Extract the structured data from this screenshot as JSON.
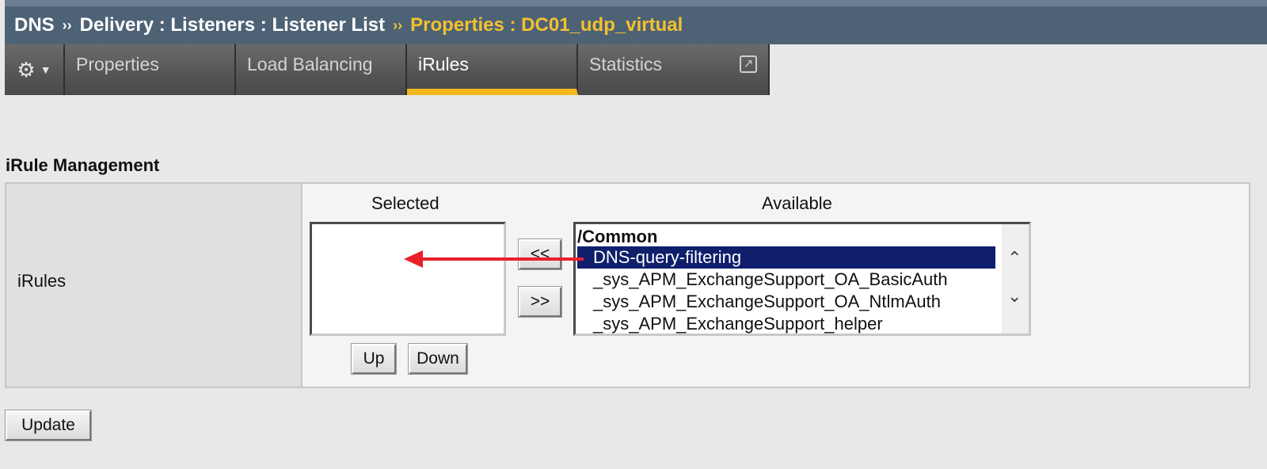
{
  "breadcrumb": {
    "root": "DNS",
    "path": "Delivery : Listeners : Listener List",
    "current": "Properties : DC01_udp_virtual",
    "separator": "››"
  },
  "tabs": [
    {
      "label": "Properties"
    },
    {
      "label": "Load Balancing"
    },
    {
      "label": "iRules",
      "active": true
    },
    {
      "label": "Statistics"
    }
  ],
  "section": {
    "title": "iRule Management"
  },
  "irules": {
    "row_label": "iRules",
    "selected_header": "Selected",
    "available_header": "Available",
    "move_left_label": "<<",
    "move_right_label": ">>",
    "up_label": "Up",
    "down_label": "Down",
    "available_group": "/Common",
    "available_items": [
      "DNS-query-filtering",
      "_sys_APM_ExchangeSupport_OA_BasicAuth",
      "_sys_APM_ExchangeSupport_OA_NtlmAuth",
      "_sys_APM_ExchangeSupport_helper"
    ],
    "selected_item_index": 0
  },
  "update_label": "Update",
  "colors": {
    "breadcrumb_bg": "#4e6276",
    "breadcrumb_current": "#f2c12e",
    "tab_active_underline": "#f2b81e",
    "selection_bg": "#0f1f6b",
    "annotation_arrow": "#e8202a"
  },
  "icons": [
    "gear-icon",
    "chevron-down-icon",
    "external-link-icon",
    "scroll-up-icon",
    "scroll-down-icon"
  ]
}
